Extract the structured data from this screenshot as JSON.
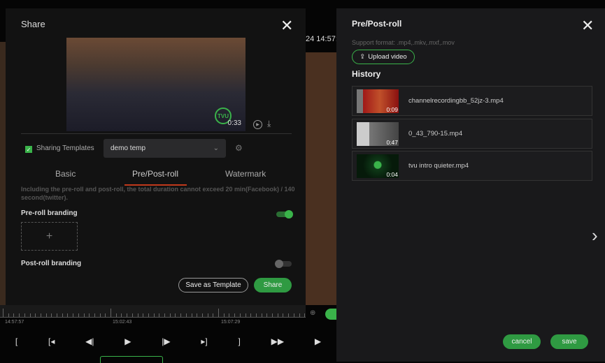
{
  "background": {
    "timestamp": "24 14:57:"
  },
  "share": {
    "title": "Share",
    "video_duration": "0:33",
    "watermark": "TVU",
    "template_label": "Sharing Templates",
    "template_checked": true,
    "template_value": "demo temp",
    "tabs": [
      {
        "label": "Basic"
      },
      {
        "label": "Pre/Post-roll",
        "active": true
      },
      {
        "label": "Watermark"
      }
    ],
    "note": "Including the pre-roll and post-roll, the total duration cannot exceed 20 min(Facebook) / 140 second(twitter).",
    "pre_roll_label": "Pre-roll branding",
    "pre_roll_enabled": true,
    "post_roll_label": "Post-roll branding",
    "post_roll_enabled": false,
    "add_symbol": "+",
    "save_template_label": "Save as Template",
    "share_label": "Share"
  },
  "panel": {
    "title": "Pre/Post-roll",
    "support_format": "Support format: .mp4,.mkv,.mxf,.mov",
    "upload_label": "Upload video",
    "history_title": "History",
    "history": [
      {
        "name": "channelrecordingbb_52jz-3.mp4",
        "duration": "0:09"
      },
      {
        "name": "0_43_790-15.mp4",
        "duration": "0:47"
      },
      {
        "name": "tvu intro quieter.mp4",
        "duration": "0:04"
      }
    ],
    "cancel_label": "cancel",
    "save_label": "save"
  },
  "timeline": {
    "labels": [
      "14:57:57",
      "15:02:43",
      "15:07:29"
    ]
  },
  "colors": {
    "accent": "#3ab34a",
    "tab_underline": "#c0391b"
  }
}
